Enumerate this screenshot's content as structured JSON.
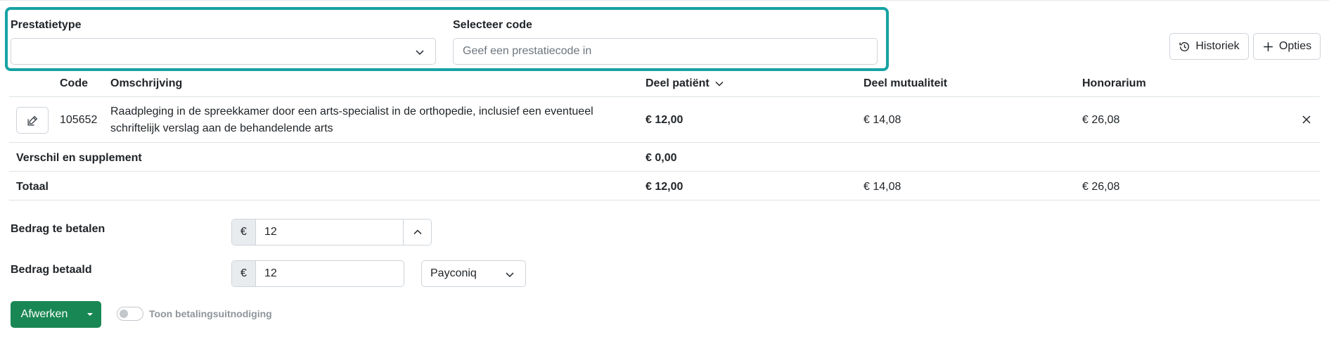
{
  "filter": {
    "type_label": "Prestatietype",
    "type_value": "",
    "code_label": "Selecteer code",
    "code_placeholder": "Geef een prestatiecode in"
  },
  "toolbar": {
    "history_label": "Historiek",
    "options_label": "Opties"
  },
  "table": {
    "headers": {
      "code": "Code",
      "description": "Omschrijving",
      "patient_share": "Deel patiënt",
      "mutuality_share": "Deel mutualiteit",
      "fee": "Honorarium"
    },
    "rows": [
      {
        "code": "105652",
        "description_line1": "Raadpleging in de spreekkamer door een arts-specialist in de orthopedie, inclusief een eventueel",
        "description_line2": "schriftelijk verslag aan de behandelende arts",
        "patient_share": "€ 12,00",
        "mutuality_share": "€ 14,08",
        "fee": "€ 26,08"
      }
    ],
    "supplement": {
      "label": "Verschil en supplement",
      "patient_share": "€ 0,00"
    },
    "total": {
      "label": "Totaal",
      "patient_share": "€ 12,00",
      "mutuality_share": "€ 14,08",
      "fee": "€ 26,08"
    }
  },
  "payment": {
    "to_pay_label": "Bedrag te betalen",
    "to_pay_currency": "€",
    "to_pay_value": "12",
    "paid_label": "Bedrag betaald",
    "paid_currency": "€",
    "paid_value": "12",
    "method": "Payconiq"
  },
  "actions": {
    "finish_label": "Afwerken",
    "toggle_label": "Toon betalingsuitnodiging",
    "toggle_on": false
  },
  "colors": {
    "highlight": "#17a2a4",
    "primary_button": "#198754"
  },
  "icons": {
    "history": "history-icon",
    "options": "plus-icon",
    "edit": "edit-icon",
    "remove": "close-icon",
    "dropdown": "chevron-down-icon",
    "stepper": "chevron-up-icon",
    "sort": "chevron-down-icon",
    "split_caret": "caret-down-icon"
  }
}
